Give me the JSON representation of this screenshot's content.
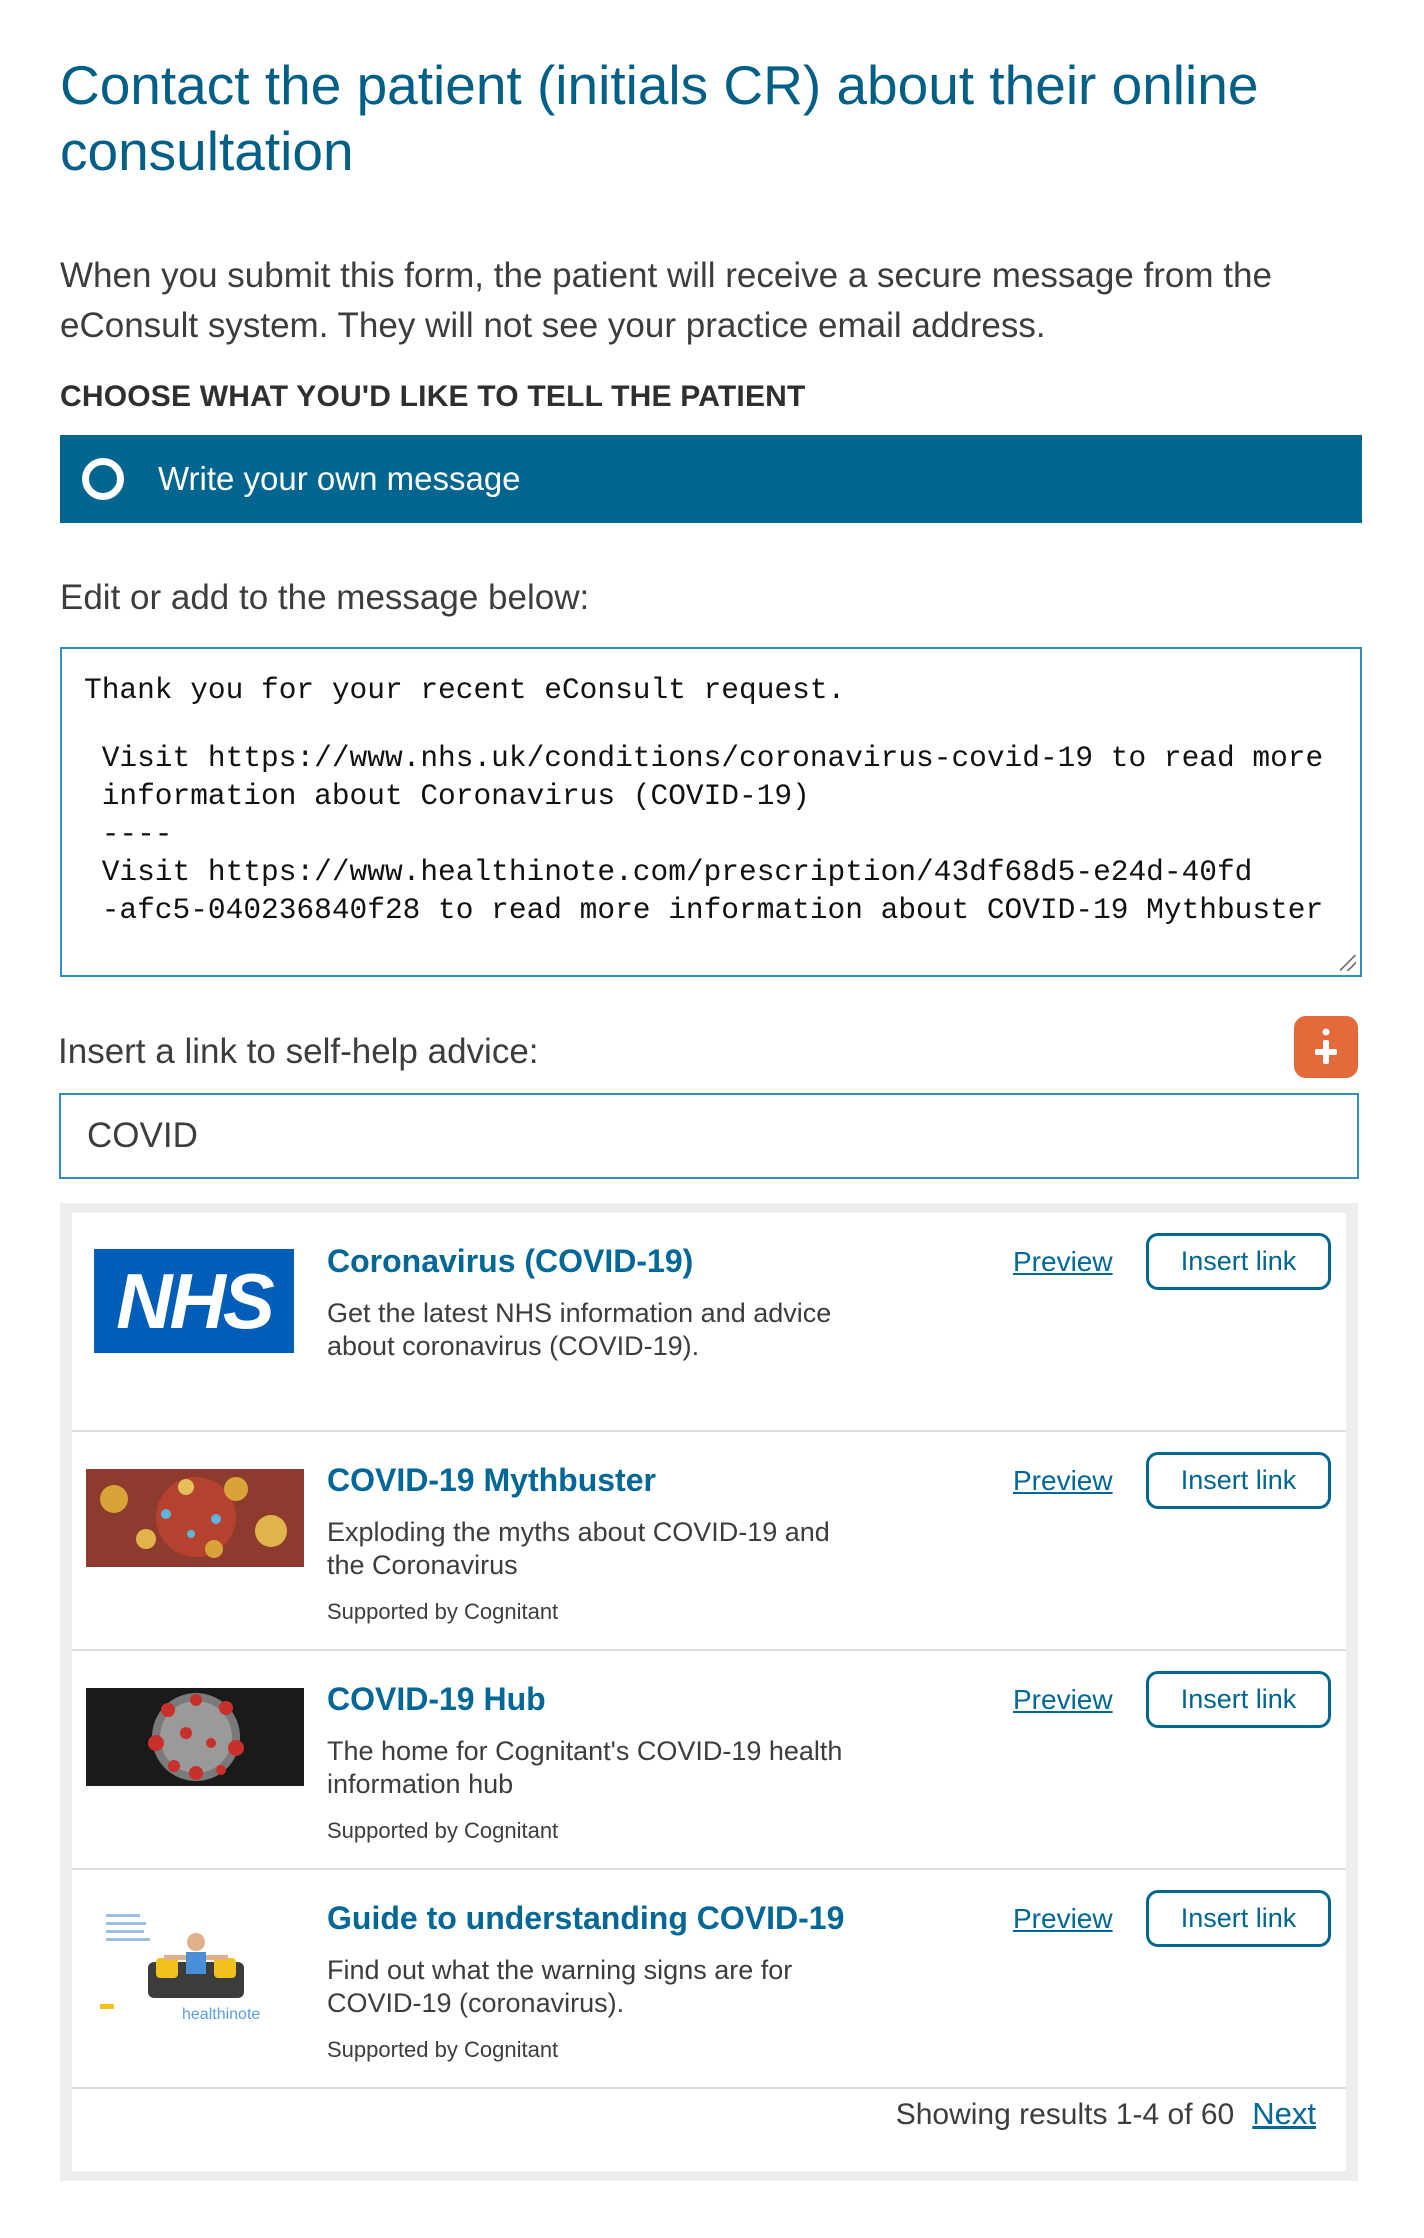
{
  "page": {
    "title": "Contact the patient (initials CR) about their online consultation",
    "intro": "When you submit this form, the patient will receive a secure message from the eConsult system. They will not see your practice email address.",
    "choose_label": "CHOOSE WHAT YOU'D LIKE TO TELL THE PATIENT"
  },
  "option": {
    "label": "Write your own message"
  },
  "message": {
    "label": "Edit or add to the message below:",
    "lines": [
      "Thank you for your recent eConsult request.",
      " Visit https://www.nhs.uk/conditions/coronavirus-covid-19 to read more",
      " information about Coronavirus (COVID-19)",
      " ----",
      " Visit https://www.healthinote.com/prescription/43df68d5-e24d-40fd",
      " -afc5-040236840f28 to read more information about COVID-19 Mythbuster"
    ]
  },
  "self_help": {
    "label": "Insert a link to self-help advice:",
    "help_icon": "info-plus-icon",
    "search_value": "COVID"
  },
  "results": {
    "preview_label": "Preview",
    "insert_label": "Insert link",
    "items": [
      {
        "title": "Coronavirus (COVID-19)",
        "description": "Get the latest NHS information and advice about coronavirus (COVID-19).",
        "support": "",
        "thumb": "nhs-logo",
        "thumb_text": "NHS"
      },
      {
        "title": "COVID-19 Mythbuster",
        "description": "Exploding the myths about COVID-19 and the Coronavirus",
        "support": "Supported by Cognitant",
        "thumb": "virus-red-image"
      },
      {
        "title": "COVID-19 Hub",
        "description": "The home for Cognitant's COVID-19 health information hub",
        "support": "Supported by Cognitant",
        "thumb": "virus-dark-image"
      },
      {
        "title": "Guide to understanding COVID-19",
        "description": "Find out what the warning signs are for COVID-19 (coronavirus).",
        "support": "Supported by Cognitant",
        "thumb": "healthinote-guide-image",
        "thumb_text": "healthinote"
      }
    ],
    "pager_text": "Showing results 1-4 of 60",
    "next_label": "Next"
  },
  "colors": {
    "title": "#005f86",
    "option_bar": "#00668f",
    "link": "#006796",
    "help_button": "#e56a3b",
    "nhs_blue": "#005eb8"
  }
}
